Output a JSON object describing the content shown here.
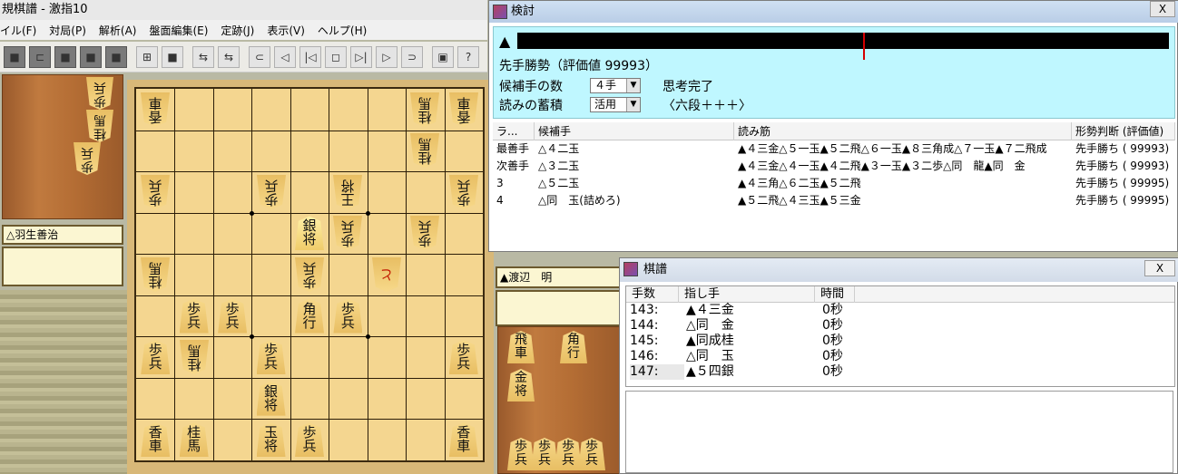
{
  "main_window": {
    "title": "規棋譜 - 激指10",
    "menu": [
      "イル(F)",
      "対局(P)",
      "解析(A)",
      "盤面編集(E)",
      "定跡(J)",
      "表示(V)",
      "ヘルプ(H)"
    ],
    "toolbar_glyphs": [
      "■",
      "⊏",
      "■",
      "■",
      "■",
      "⊞",
      "■",
      "⇆",
      "⇆",
      "⊂",
      "◁",
      "|◁",
      "◻",
      "▷|",
      "▷",
      "⊃",
      "▣",
      "?"
    ]
  },
  "players": {
    "white": "△羽生善治",
    "black": "▲渡辺　明"
  },
  "board": {
    "pieces": [
      {
        "file": 9,
        "rank": 1,
        "label": "香車",
        "side": "white"
      },
      {
        "file": 2,
        "rank": 1,
        "label": "桂馬",
        "side": "white"
      },
      {
        "file": 1,
        "rank": 1,
        "label": "香車",
        "side": "white"
      },
      {
        "file": 2,
        "rank": 2,
        "label": "桂馬",
        "side": "white"
      },
      {
        "file": 9,
        "rank": 3,
        "label": "歩兵",
        "side": "white"
      },
      {
        "file": 6,
        "rank": 3,
        "label": "歩兵",
        "side": "white"
      },
      {
        "file": 4,
        "rank": 3,
        "label": "王将",
        "side": "white"
      },
      {
        "file": 1,
        "rank": 3,
        "label": "歩兵",
        "side": "white"
      },
      {
        "file": 5,
        "rank": 4,
        "label": "銀将",
        "side": "black",
        "highlight": true
      },
      {
        "file": 4,
        "rank": 4,
        "label": "歩兵",
        "side": "white"
      },
      {
        "file": 2,
        "rank": 4,
        "label": "歩兵",
        "side": "white"
      },
      {
        "file": 9,
        "rank": 5,
        "label": "桂馬",
        "side": "white"
      },
      {
        "file": 5,
        "rank": 5,
        "label": "歩兵",
        "side": "white"
      },
      {
        "file": 3,
        "rank": 5,
        "label": "と",
        "side": "white",
        "promoted": true
      },
      {
        "file": 8,
        "rank": 6,
        "label": "歩兵",
        "side": "black"
      },
      {
        "file": 7,
        "rank": 6,
        "label": "歩兵",
        "side": "black"
      },
      {
        "file": 5,
        "rank": 6,
        "label": "角行",
        "side": "black"
      },
      {
        "file": 4,
        "rank": 6,
        "label": "歩兵",
        "side": "black"
      },
      {
        "file": 9,
        "rank": 7,
        "label": "歩兵",
        "side": "black"
      },
      {
        "file": 8,
        "rank": 7,
        "label": "桂馬",
        "side": "white"
      },
      {
        "file": 6,
        "rank": 7,
        "label": "歩兵",
        "side": "black"
      },
      {
        "file": 1,
        "rank": 7,
        "label": "歩兵",
        "side": "black"
      },
      {
        "file": 6,
        "rank": 8,
        "label": "銀将",
        "side": "black"
      },
      {
        "file": 9,
        "rank": 9,
        "label": "香車",
        "side": "black"
      },
      {
        "file": 8,
        "rank": 9,
        "label": "桂馬",
        "side": "black"
      },
      {
        "file": 6,
        "rank": 9,
        "label": "玉将",
        "side": "black"
      },
      {
        "file": 5,
        "rank": 9,
        "label": "歩兵",
        "side": "black"
      },
      {
        "file": 1,
        "rank": 9,
        "label": "香車",
        "side": "black"
      }
    ],
    "white_hand": [
      "歩兵",
      "桂馬",
      "歩兵"
    ],
    "black_hand": [
      "飛車",
      "角行",
      "金将",
      "歩兵",
      "歩兵",
      "歩兵",
      "歩兵"
    ]
  },
  "analysis": {
    "title": "検討",
    "close": "X",
    "sente_mark": "▲",
    "arrow": "〉",
    "evaluation_fraction": 0.53,
    "status": "先手勝勢（評価値 99993）",
    "candidates_label": "候補手の数",
    "candidates_value": "４手",
    "accumulate_label": "読みの蓄積",
    "accumulate_value": "活用",
    "think_status": "思考完了",
    "engine": "〈六段＋＋＋〉",
    "columns": [
      "ラ...",
      "候補手",
      "読み筋",
      "形勢判断 (評価値)"
    ],
    "rows": [
      {
        "rank": "最善手",
        "move": "△４二玉",
        "pv": "▲４三金△５一玉▲５二飛△６一玉▲８三角成△７一玉▲７二飛成",
        "eval": "先手勝ち ( 99993)"
      },
      {
        "rank": "次善手",
        "move": "△３二玉",
        "pv": "▲４三金△４一玉▲４二飛▲３一玉▲３二歩△同　龍▲同　金",
        "eval": "先手勝ち ( 99993)"
      },
      {
        "rank": "3",
        "move": "△５二玉",
        "pv": "▲４三角△６二玉▲５二飛",
        "eval": "先手勝ち ( 99995)"
      },
      {
        "rank": "4",
        "move": "△同　玉(詰めろ)",
        "pv": "▲５二飛△４三玉▲５三金",
        "eval": "先手勝ち ( 99995)"
      }
    ]
  },
  "kifu": {
    "title": "棋譜",
    "close": "X",
    "columns": [
      "手数",
      "指し手",
      "時間"
    ],
    "rows": [
      {
        "no": "143:",
        "move": "▲４三金",
        "time": "0秒"
      },
      {
        "no": "144:",
        "move": "△同　金",
        "time": "0秒"
      },
      {
        "no": "145:",
        "move": "▲同成桂",
        "time": "0秒"
      },
      {
        "no": "146:",
        "move": "△同　玉",
        "time": "0秒"
      },
      {
        "no": "147:",
        "move": "▲５四銀",
        "time": "0秒"
      }
    ]
  }
}
